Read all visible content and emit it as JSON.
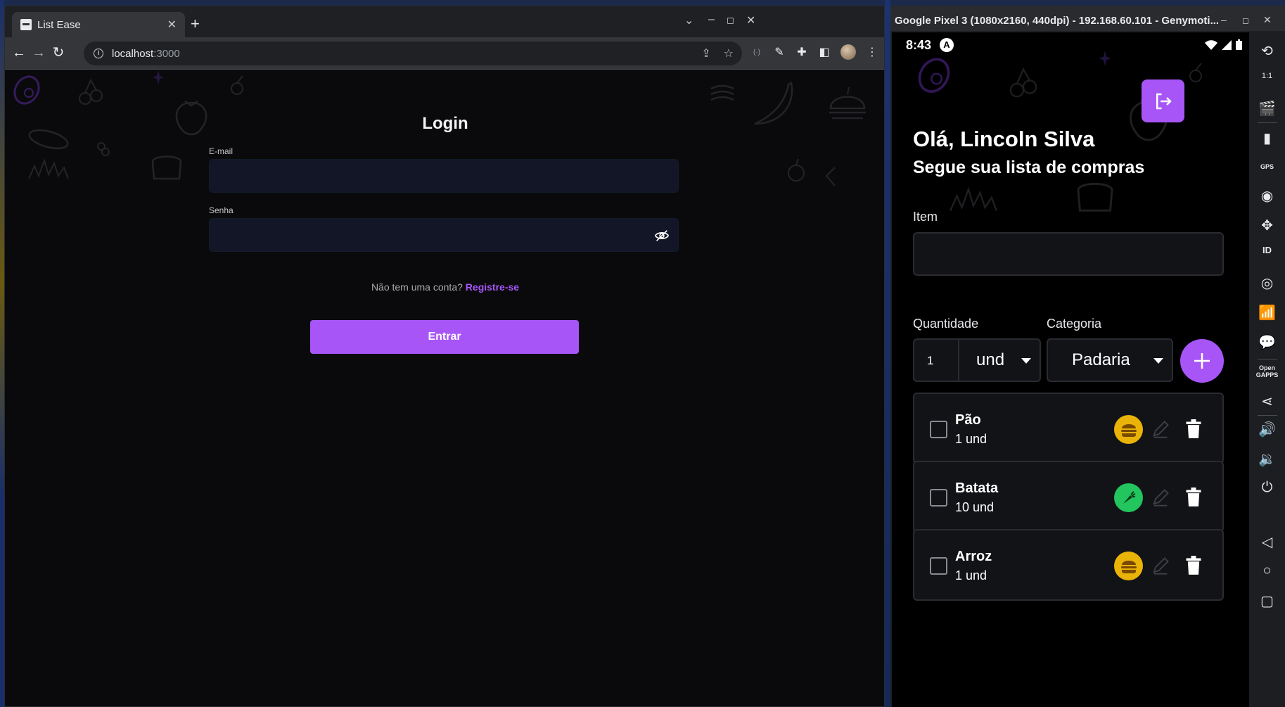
{
  "browser": {
    "tab_title": "List Ease",
    "tab_close": "✕",
    "new_tab": "+",
    "url_host": "localhost",
    "url_port": ":3000"
  },
  "login": {
    "title": "Login",
    "email_label": "E-mail",
    "email_value": "",
    "password_label": "Senha",
    "password_value": "",
    "register_prompt": "Não tem uma conta?",
    "register_link": "Registre-se",
    "submit_label": "Entrar"
  },
  "emulator": {
    "title": "Google Pixel 3 (1080x2160, 440dpi) - 192.168.60.101 - Genymoti...",
    "status_time": "8:43",
    "status_badge": "A",
    "sidebar_labels": {
      "gps": "GPS",
      "id": "ID",
      "gapps": "Open GAPPS",
      "ratio": "1:1"
    }
  },
  "app": {
    "greeting": "Olá, Lincoln Silva",
    "subtitle": "Segue sua lista de compras",
    "item_label": "Item",
    "item_value": "",
    "quantity_label": "Quantidade",
    "quantity_value": "1",
    "unit_value": "und",
    "category_label": "Categoria",
    "category_value": "Padaria",
    "items": [
      {
        "name": "Pão",
        "qty": "1 und",
        "category_icon": "burger-icon",
        "category_color": "#eab308"
      },
      {
        "name": "Batata",
        "qty": "10 und",
        "category_icon": "carrot-icon",
        "category_color": "#22c55e"
      },
      {
        "name": "Arroz",
        "qty": "1 und",
        "category_icon": "burger-icon",
        "category_color": "#eab308"
      }
    ]
  },
  "colors": {
    "accent": "#a855f7",
    "page_bg": "#0a0a0c",
    "input_bg": "#121626",
    "bakery": "#eab308",
    "vegetable": "#22c55e"
  }
}
